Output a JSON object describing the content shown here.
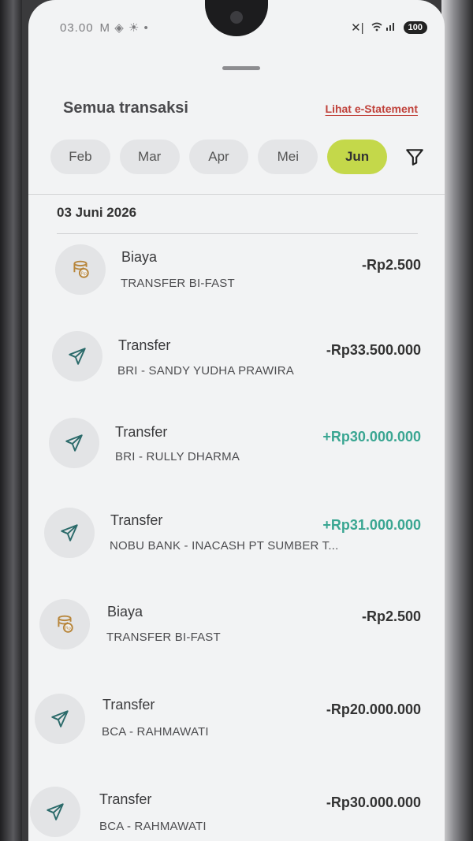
{
  "status_bar": {
    "time": "03.00",
    "status_icons": "M ◈ ☀ •",
    "battery": "100"
  },
  "header": {
    "title": "Semua transaksi",
    "statement_link": "Lihat e-Statement"
  },
  "months": [
    {
      "label": "Feb",
      "active": false
    },
    {
      "label": "Mar",
      "active": false
    },
    {
      "label": "Apr",
      "active": false
    },
    {
      "label": "Mei",
      "active": false
    },
    {
      "label": "Jun",
      "active": true
    }
  ],
  "icons": {
    "filter": "filter-icon",
    "fee": "coin-stack-icon",
    "transfer": "paper-plane-icon"
  },
  "colors": {
    "accent_chip": "#c4d84a",
    "credit": "#3aa692",
    "link": "#c0413a"
  },
  "date_group": "03 Juni 2026",
  "transactions": [
    {
      "type": "Biaya",
      "description": "TRANSFER BI-FAST",
      "amount": "-Rp2.500",
      "icon": "coin-stack-icon",
      "credit": false
    },
    {
      "type": "Transfer",
      "description": "BRI - SANDY YUDHA PRAWIRA",
      "amount": "-Rp33.500.000",
      "icon": "paper-plane-icon",
      "credit": false
    },
    {
      "type": "Transfer",
      "description": "BRI - RULLY DHARMA",
      "amount": "+Rp30.000.000",
      "icon": "paper-plane-icon",
      "credit": true
    },
    {
      "type": "Transfer",
      "description": "NOBU BANK - INACASH PT SUMBER T...",
      "amount": "+Rp31.000.000",
      "icon": "paper-plane-icon",
      "credit": true
    },
    {
      "type": "Biaya",
      "description": "TRANSFER BI-FAST",
      "amount": "-Rp2.500",
      "icon": "coin-stack-icon",
      "credit": false
    },
    {
      "type": "Transfer",
      "description": "BCA - RAHMAWATI",
      "amount": "-Rp20.000.000",
      "icon": "paper-plane-icon",
      "credit": false
    },
    {
      "type": "Transfer",
      "description": "BCA - RAHMAWATI",
      "amount": "-Rp30.000.000",
      "icon": "paper-plane-icon",
      "credit": false
    }
  ]
}
